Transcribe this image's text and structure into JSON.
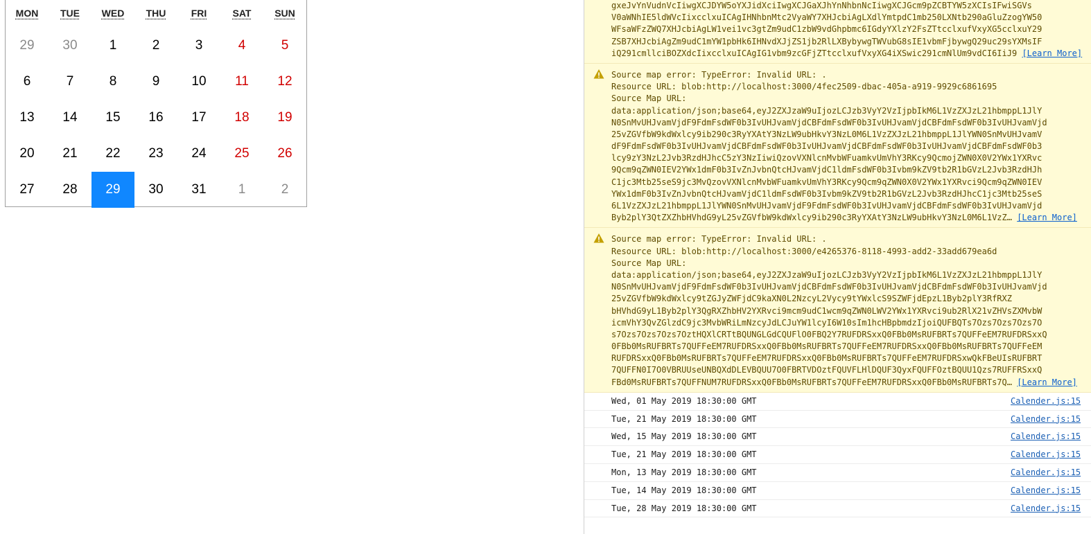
{
  "calendar": {
    "weekdays": [
      {
        "abbr": "MON",
        "title": "Monday"
      },
      {
        "abbr": "TUE",
        "title": "Tuesday"
      },
      {
        "abbr": "WED",
        "title": "Wednesday"
      },
      {
        "abbr": "THU",
        "title": "Thursday"
      },
      {
        "abbr": "FRI",
        "title": "Friday"
      },
      {
        "abbr": "SAT",
        "title": "Saturday"
      },
      {
        "abbr": "SUN",
        "title": "Sunday"
      }
    ],
    "weeks": [
      [
        {
          "d": "29",
          "neighbor": true
        },
        {
          "d": "30",
          "neighbor": true
        },
        {
          "d": "1"
        },
        {
          "d": "2"
        },
        {
          "d": "3"
        },
        {
          "d": "4",
          "weekend": true
        },
        {
          "d": "5",
          "weekend": true
        }
      ],
      [
        {
          "d": "6"
        },
        {
          "d": "7"
        },
        {
          "d": "8"
        },
        {
          "d": "9"
        },
        {
          "d": "10"
        },
        {
          "d": "11",
          "weekend": true
        },
        {
          "d": "12",
          "weekend": true
        }
      ],
      [
        {
          "d": "13"
        },
        {
          "d": "14"
        },
        {
          "d": "15"
        },
        {
          "d": "16"
        },
        {
          "d": "17"
        },
        {
          "d": "18",
          "weekend": true
        },
        {
          "d": "19",
          "weekend": true
        }
      ],
      [
        {
          "d": "20"
        },
        {
          "d": "21"
        },
        {
          "d": "22"
        },
        {
          "d": "23"
        },
        {
          "d": "24"
        },
        {
          "d": "25",
          "weekend": true
        },
        {
          "d": "26",
          "weekend": true
        }
      ],
      [
        {
          "d": "27"
        },
        {
          "d": "28"
        },
        {
          "d": "29",
          "active": true
        },
        {
          "d": "30"
        },
        {
          "d": "31"
        },
        {
          "d": "1",
          "neighbor": true,
          "weekend": true
        },
        {
          "d": "2",
          "neighbor": true,
          "weekend": true
        }
      ]
    ],
    "colors": {
      "active_bg": "#1087ff",
      "weekend": "#d10000",
      "neighbor": "#8a8a8a"
    }
  },
  "console": {
    "warnings": [
      {
        "lines": [
          "gxeJvYnVudnVcIiwgXCJDYW5oYXJidXciIwgXCJGaXJhYnNhbnNcIiwgXCJGcm9pZCBTYW5zXCIsIFwiSGVs",
          "V0aWNhIE5ldWVcIixcclxuICAgIHNhbnMtc2VyaWY7XHJcbiAgLXdlYmtpdC1mb250LXNtb290aGluZzogYW50",
          "WFsaWFzZWQ7XHJcbiAgLW1vei1vc3gtZm9udC1zbW9vdGhpbmc6IGdyYXlzY2FsZTtcclxufVxyXG5cclxuY29",
          "ZSB7XHJcbiAgZm9udC1mYW1pbHk6IHNvdXJjZS1jb2RlLXBybywgTWVubG8sIE1vbmFjbywgQ29uc29sYXMsIF",
          "iQ291cmllciBOZXdcIixcclxuICAgIG1vbm9zcGFjZTtcclxufVxyXG4iXSwic291cmNlUm9vdCI6IiJ9"
        ],
        "tail": "[Learn More]"
      },
      {
        "lines": [
          "Source map error: TypeError: Invalid URL: .",
          "Resource URL: blob:http://localhost:3000/4fec2509-dbac-405a-a919-9929c6861695",
          "Source Map URL:",
          "data:application/json;base64,eyJ2ZXJzaW9uIjozLCJzb3VyY2VzIjpbIkM6L1VzZXJzL21hbmppL1JlY",
          "N0SnMvUHJvamVjdF9FdmFsdWF0b3IvUHJvamVjdCBFdmFsdWF0b3IvUHJvamVjdCBFdmFsdWF0b3IvUHJvamVjd",
          "25vZGVfbW9kdWxlcy9ib290c3RyYXAtY3NzLW9ubHkvY3NzL0M6L1VzZXJzL21hbmppL1JlYWN0SnMvUHJvamV",
          "dF9FdmFsdWF0b3IvUHJvamVjdCBFdmFsdWF0b3IvUHJvamVjdCBFdmFsdWF0b3IvUHJvamVjdCBFdmFsdWF0b3",
          "lcy9zY3NzL2Jvb3RzdHJhcC5zY3NzIiwiQzovVXNlcnMvbWFuamkvUmVhY3RKcy9QcmojZWN0X0V2YWx1YXRvc",
          "9Qcm9qZWN0IEV2YWx1dmF0b3IvZnJvbnQtcHJvamVjdC1ldmFsdWF0b3Ivbm9kZV9tb2R1bGVzL2Jvb3RzdHJh",
          "C1jc3Mtb25seS9jc3MvQzovVXNlcnMvbWFuamkvUmVhY3RKcy9Qcm9qZWN0X0V2YWx1YXRvci9Qcm9qZWN0IEV",
          "YWx1dmF0b3IvZnJvbnQtcHJvamVjdC1ldmFsdWF0b3Ivbm9kZV9tb2R1bGVzL2Jvb3RzdHJhcC1jc3Mtb25seS",
          "6L1VzZXJzL21hbmppL1JlYWN0SnMvUHJvamVjdF9FdmFsdWF0b3IvUHJvamVjdCBFdmFsdWF0b3IvUHJvamVjd",
          "Byb2plY3QtZXZhbHVhdG9yL25vZGVfbW9kdWxlcy9ib290c3RyYXAtY3NzLW9ubHkvY3NzL0M6L1VzZ…"
        ],
        "tail": "[Learn More]"
      },
      {
        "lines": [
          "Source map error: TypeError: Invalid URL: .",
          "Resource URL: blob:http://localhost:3000/e4265376-8118-4993-add2-33add679ea6d",
          "Source Map URL:",
          "data:application/json;base64,eyJ2ZXJzaW9uIjozLCJzb3VyY2VzIjpbIkM6L1VzZXJzL21hbmppL1JlY",
          "N0SnMvUHJvamVjdF9FdmFsdWF0b3IvUHJvamVjdCBFdmFsdWF0b3IvUHJvamVjdCBFdmFsdWF0b3IvUHJvamVjd",
          "25vZGVfbW9kdWxlcy9tZGJyZWFjdC9kaXN0L2NzcyL2Vycy9tYWxlcS9SZWFjdEpzL1Byb2plY3RfRXZ",
          "bHVhdG9yL1Byb2plY3QgRXZhbHV2YXRvci9mcm9udC1wcm9qZWN0LWV2YWx1YXRvci9ub2RlX21vZHVsZXMvbW",
          "icmVhY3QvZGlzdC9jc3MvbWRiLmNzcyJdLCJuYW1lcyI6W10sIm1hcHBpbmdzIjoiQUFBQTs7Ozs7Ozs7Ozs7O",
          "s7Ozs7Ozs7Ozs7OztHQXlCRTtBQUNGLGdCQUFlO0FBQ2Y7RUFDRSxxQ0FBb0MsRUFBRTs7QUFFeEM7RUFDRSxxQ",
          "0FBb0MsRUFBRTs7QUFFeEM7RUFDRSxxQ0FBb0MsRUFBRTs7QUFFeEM7RUFDRSxxQ0FBb0MsRUFBRTs7QUFFeEM",
          "RUFDRSxxQ0FBb0MsRUFBRTs7QUFFeEM7RUFDRSxxQ0FBb0MsRUFBRTs7QUFFeEM7RUFDRSxwQkFBeUIsRUFBRT",
          "7QUFFN0I7O0VBRUUseUNBQXdDLEVBQUU7O0FBRTVDOztFQUVFLHlDQUF3QyxFQUFFOztBQUU1Qzs7RUFFRSxxQ",
          "FBd0MsRUFBRTs7QUFFNUM7RUFDRSxxQ0FBb0MsRUFBRTs7QUFFeEM7RUFDRSxxQ0FBb0MsRUFBRTs7Q…"
        ],
        "tail": "[Learn More]"
      }
    ],
    "logs": [
      {
        "text": "Wed, 01 May 2019 18:30:00 GMT",
        "source": "Calender.js:15"
      },
      {
        "text": "Tue, 21 May 2019 18:30:00 GMT",
        "source": "Calender.js:15"
      },
      {
        "text": "Wed, 15 May 2019 18:30:00 GMT",
        "source": "Calender.js:15"
      },
      {
        "text": "Tue, 21 May 2019 18:30:00 GMT",
        "source": "Calender.js:15"
      },
      {
        "text": "Mon, 13 May 2019 18:30:00 GMT",
        "source": "Calender.js:15"
      },
      {
        "text": "Tue, 14 May 2019 18:30:00 GMT",
        "source": "Calender.js:15"
      },
      {
        "text": "Tue, 28 May 2019 18:30:00 GMT",
        "source": "Calender.js:15"
      }
    ],
    "colors": {
      "warning_bg": "#fffbd6",
      "warning_text": "#5f4c00",
      "link": "#1a5fb4"
    }
  }
}
